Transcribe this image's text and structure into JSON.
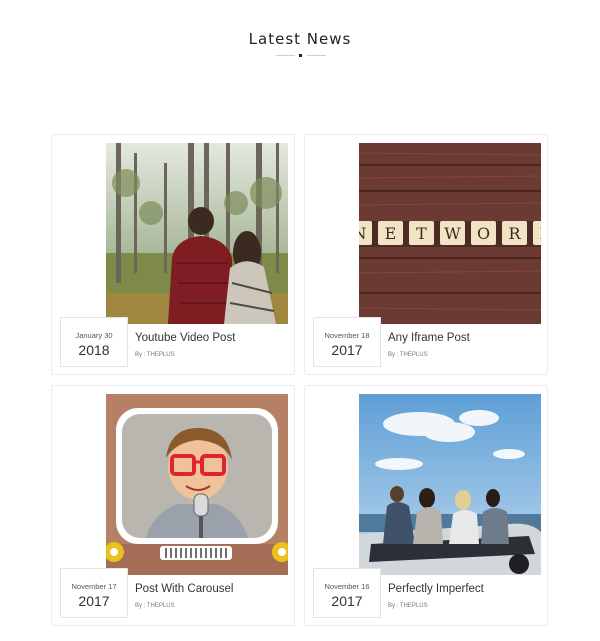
{
  "section": {
    "title": "Latest News"
  },
  "posts": [
    {
      "title": "Youtube Video Post",
      "month_day": "January 30",
      "year": "2018",
      "author": "By : THEPLUS",
      "image": "forest-couple-photo"
    },
    {
      "title": "Any Iframe Post",
      "month_day": "November 18",
      "year": "2017",
      "author": "By : THEPLUS",
      "image": "network-tiles-photo",
      "tile_letters": [
        "N",
        "E",
        "T",
        "W",
        "O",
        "R",
        "K"
      ]
    },
    {
      "title": "Post With Carousel",
      "month_day": "November 17",
      "year": "2017",
      "author": "By : THEPLUS",
      "image": "child-tv-box-photo"
    },
    {
      "title": "Perfectly Imperfect",
      "month_day": "November 16",
      "year": "2017",
      "author": "By : THEPLUS",
      "image": "friends-convertible-photo"
    }
  ],
  "colors": {
    "accent": "#222222",
    "card_border": "#ececec",
    "divider": "#cfcfcf"
  }
}
